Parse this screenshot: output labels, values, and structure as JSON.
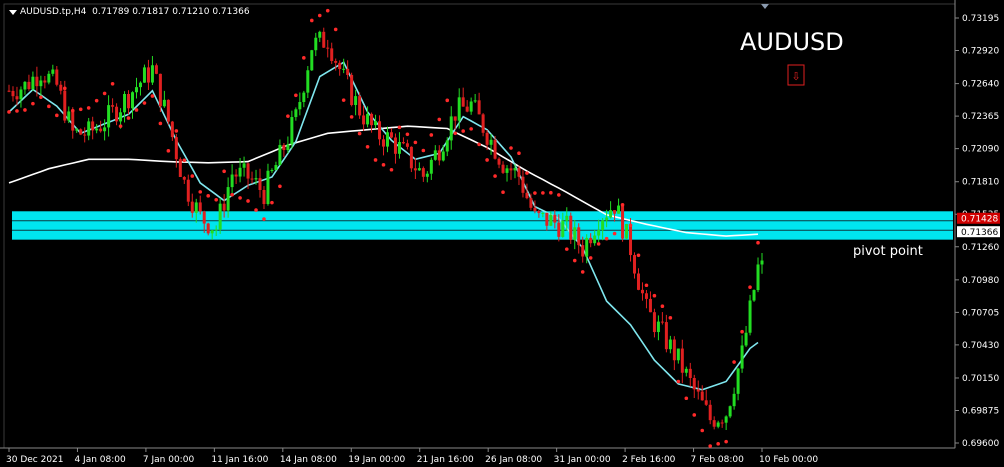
{
  "header": {
    "symbol": "AUDUSD.tp,H4",
    "ohlc": "0.71789 0.71817 0.71210 0.71366",
    "big_title": "AUDUSD"
  },
  "annotation": {
    "pivot_label": "pivot point"
  },
  "colors": {
    "background": "#000000",
    "bull": "#22dd22",
    "bear": "#e02020",
    "sar": "#ff2a2a",
    "ma_fast": "#7fe6ee",
    "ma_slow": "#ffffff",
    "pivot_zone": "#00e5f0",
    "price_tag_red": "#d00000",
    "price_tag_white": "#ffffff"
  },
  "chart_data": {
    "type": "candlestick",
    "y_ticks": [
      "0.73195",
      "0.72920",
      "0.72640",
      "0.72365",
      "0.72090",
      "0.71810",
      "0.71535",
      "0.71260",
      "0.70980",
      "0.70705",
      "0.70430",
      "0.70150",
      "0.69875",
      "0.69600"
    ],
    "y_range": [
      0.6959,
      0.7327
    ],
    "x_ticks": [
      "30 Dec 2021",
      "4 Jan 08:00",
      "7 Jan 00:00",
      "11 Jan 16:00",
      "14 Jan 08:00",
      "19 Jan 00:00",
      "21 Jan 16:00",
      "26 Jan 08:00",
      "31 Jan 00:00",
      "2 Feb 16:00",
      "7 Feb 08:00",
      "10 Feb 00:00"
    ],
    "pivot_zone": [
      0.7132,
      0.7156
    ],
    "pivot_lines": [
      0.7148,
      0.714
    ],
    "price_tags": [
      "0.71428",
      "0.71366"
    ],
    "candle_count": 190,
    "anchors": [
      [
        0,
        0.7258
      ],
      [
        4,
        0.7262
      ],
      [
        8,
        0.7275
      ],
      [
        12,
        0.7262
      ],
      [
        16,
        0.7222
      ],
      [
        20,
        0.7222
      ],
      [
        24,
        0.7232
      ],
      [
        28,
        0.7246
      ],
      [
        32,
        0.7262
      ],
      [
        36,
        0.7276
      ],
      [
        40,
        0.7232
      ],
      [
        44,
        0.718
      ],
      [
        48,
        0.7151
      ],
      [
        52,
        0.7142
      ],
      [
        56,
        0.7188
      ],
      [
        60,
        0.7185
      ],
      [
        64,
        0.7172
      ],
      [
        68,
        0.7202
      ],
      [
        72,
        0.7235
      ],
      [
        76,
        0.7296
      ],
      [
        80,
        0.7302
      ],
      [
        84,
        0.7268
      ],
      [
        88,
        0.7242
      ],
      [
        92,
        0.7222
      ],
      [
        96,
        0.7216
      ],
      [
        100,
        0.7202
      ],
      [
        104,
        0.7186
      ],
      [
        108,
        0.721
      ],
      [
        112,
        0.724
      ],
      [
        116,
        0.7246
      ],
      [
        120,
        0.7222
      ],
      [
        124,
        0.7197
      ],
      [
        128,
        0.7186
      ],
      [
        132,
        0.715
      ],
      [
        136,
        0.7148
      ],
      [
        140,
        0.7142
      ],
      [
        144,
        0.7125
      ],
      [
        148,
        0.7151
      ],
      [
        152,
        0.7162
      ],
      [
        156,
        0.7125
      ],
      [
        160,
        0.7072
      ],
      [
        164,
        0.7052
      ],
      [
        168,
        0.703
      ],
      [
        172,
        0.7004
      ],
      [
        176,
        0.698
      ],
      [
        180,
        0.6986
      ],
      [
        184,
        0.7035
      ],
      [
        188,
        0.7108
      ]
    ],
    "ma_fast": [
      [
        0,
        0.724
      ],
      [
        6,
        0.7259
      ],
      [
        12,
        0.7245
      ],
      [
        18,
        0.7222
      ],
      [
        24,
        0.723
      ],
      [
        30,
        0.7238
      ],
      [
        36,
        0.7258
      ],
      [
        42,
        0.7216
      ],
      [
        48,
        0.718
      ],
      [
        54,
        0.7165
      ],
      [
        60,
        0.7178
      ],
      [
        66,
        0.7185
      ],
      [
        72,
        0.7215
      ],
      [
        78,
        0.727
      ],
      [
        84,
        0.7282
      ],
      [
        90,
        0.724
      ],
      [
        96,
        0.7216
      ],
      [
        102,
        0.72
      ],
      [
        108,
        0.7205
      ],
      [
        114,
        0.7236
      ],
      [
        120,
        0.7225
      ],
      [
        126,
        0.7202
      ],
      [
        132,
        0.716
      ],
      [
        138,
        0.715
      ],
      [
        144,
        0.7125
      ],
      [
        150,
        0.708
      ],
      [
        156,
        0.706
      ],
      [
        162,
        0.703
      ],
      [
        168,
        0.701
      ],
      [
        174,
        0.7005
      ],
      [
        180,
        0.7012
      ],
      [
        186,
        0.704
      ],
      [
        190,
        0.705
      ]
    ],
    "ma_slow": [
      [
        0,
        0.718
      ],
      [
        10,
        0.7192
      ],
      [
        20,
        0.72
      ],
      [
        30,
        0.72
      ],
      [
        40,
        0.7198
      ],
      [
        50,
        0.7197
      ],
      [
        60,
        0.7198
      ],
      [
        70,
        0.7212
      ],
      [
        80,
        0.7222
      ],
      [
        90,
        0.7225
      ],
      [
        100,
        0.7228
      ],
      [
        110,
        0.7226
      ],
      [
        120,
        0.721
      ],
      [
        130,
        0.719
      ],
      [
        140,
        0.7172
      ],
      [
        150,
        0.7153
      ],
      [
        160,
        0.7145
      ],
      [
        170,
        0.7138
      ],
      [
        180,
        0.7135
      ],
      [
        190,
        0.7137
      ]
    ]
  }
}
